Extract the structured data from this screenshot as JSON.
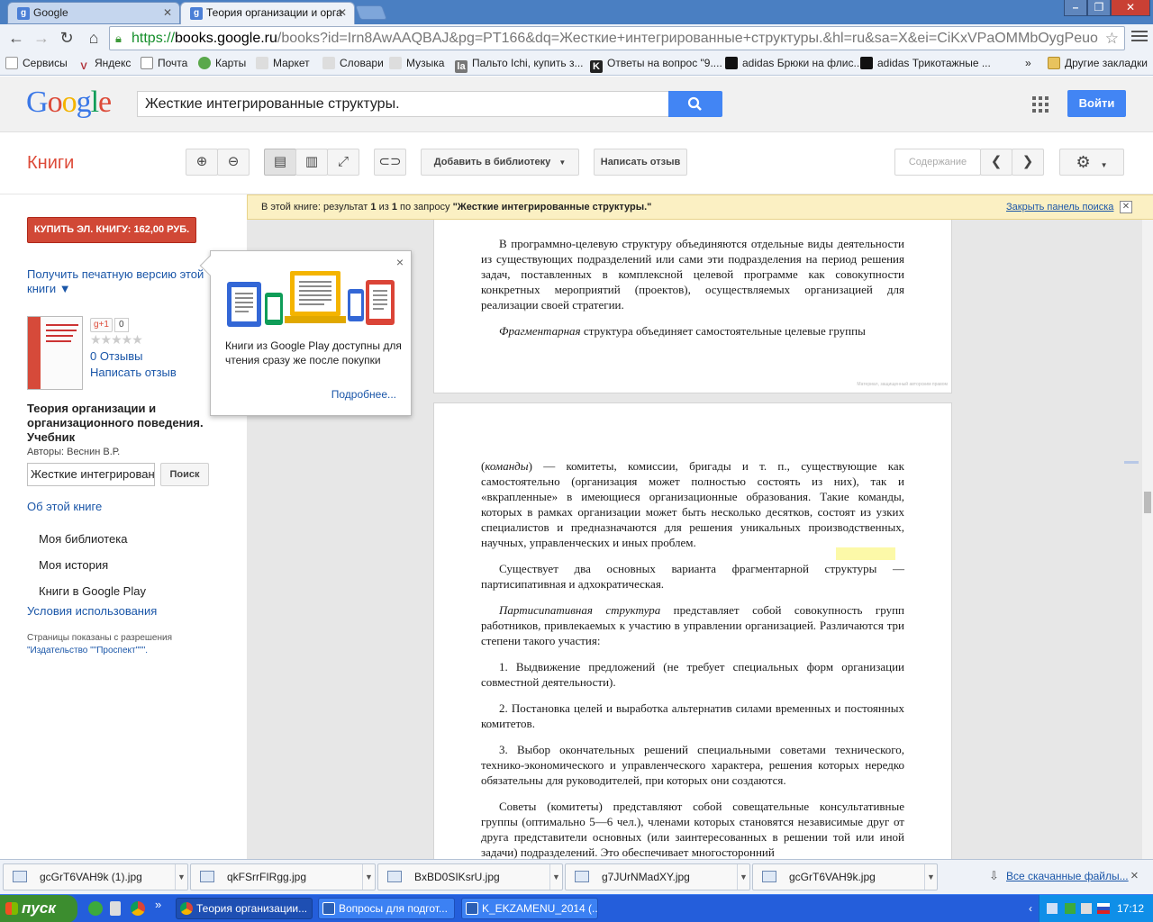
{
  "browser": {
    "tabs": [
      {
        "label": "Google",
        "favicon": "g"
      },
      {
        "label": "Теория организации и орга",
        "favicon": "g"
      }
    ],
    "window_controls": {
      "minimize": "–",
      "maximize": "❐",
      "close": "✕"
    },
    "url": {
      "scheme": "https://",
      "host": "books.google.ru",
      "path": "/books?id=Irn8AwAAQBAJ&pg=PT166&dq=Жесткие+интегрированные+структуры.&hl=ru&sa=X&ei=CiKxVPaOMMbOygPeuo"
    },
    "bookmarks": [
      {
        "label": "Сервисы"
      },
      {
        "label": "Яндекс"
      },
      {
        "label": "Почта"
      },
      {
        "label": "Карты"
      },
      {
        "label": "Маркет"
      },
      {
        "label": "Словари"
      },
      {
        "label": "Музыка"
      },
      {
        "label": "Пальто Ichi, купить з..."
      },
      {
        "label": "Ответы на вопрос \"9...."
      },
      {
        "label": "adidas Брюки на флис..."
      },
      {
        "label": "adidas Трикотажные ..."
      }
    ],
    "bookmarks_more": "»",
    "other_bookmarks": "Другие закладки"
  },
  "google": {
    "logo": "Google",
    "search_value": "Жесткие интегрированные структуры.",
    "signin": "Войти"
  },
  "books": {
    "title": "Книги",
    "add_to_library": "Добавить в библиотеку",
    "write_review": "Написать отзыв",
    "contents": "Содержание",
    "search_banner": {
      "prefix": "В этой книге: результат ",
      "current": "1",
      "of": " из ",
      "total": "1",
      "query_label": " по запросу ",
      "query": "\"Жесткие интегрированные структуры.\"",
      "close_link": "Закрыть панель поиска"
    }
  },
  "sidebar": {
    "buy_button": "КУПИТЬ ЭЛ. КНИГУ: 162,00 РУБ.",
    "print_version": "Получить печатную версию этой книги ▼",
    "gplus_label": "g+1",
    "gplus_count": "0",
    "rating_stars": "★★★★★",
    "reviews_link": "0 Отзывы",
    "write_review_link": "Написать отзыв",
    "book_title": "Теория организации и организационного поведения. Учебник",
    "authors": "Авторы: Веснин В.Р.",
    "search_input": "Жесткие интегрирован",
    "search_button": "Поиск",
    "about_link": "Об этой книге",
    "nav": [
      "Моя библиотека",
      "Моя история",
      "Книги в Google Play"
    ],
    "terms_link": "Условия использования",
    "permission_text": "Страницы показаны с разрешения",
    "publisher": "\"Издательство \"\"Проспект\"\"\"."
  },
  "popup": {
    "text": "Книги из Google Play доступны для чтения сразу же после покупки",
    "more_link": "Подробнее...",
    "close": "×"
  },
  "page1": {
    "paragraph1": "В программно-целевую структуру объединяются отдельные виды деятельности из существующих подразделений или сами эти подразделения на период решения задач, поставленных в комплексной целевой программе как совокупности конкретных мероприятий (проектов), осуществляемых организацией для реализации своей стратегии.",
    "paragraph2_term": "Фрагментарная",
    "paragraph2_rest": " структура объединяет самостоятельные целевые группы",
    "watermark": "Материал, защищенный авторским правом"
  },
  "page2": {
    "p1_open": "(",
    "p1_term": "команды",
    "p1_rest": ") — комитеты, комиссии, бригады и т. п., существующие как самостоятельно (организация может полностью состоять из них), так и «вкрапленные» в имеющиеся организационные образования. Такие команды, которых в рамках организации может быть несколько десятков, состоят из узких специалистов и предназначаются для решения уникальных производственных, научных, управленческих и иных проблем.",
    "p2": "Существует два основных варианта фрагментарной структуры — партисипативная и адхократическая.",
    "p3_term": "Партисипативная структура",
    "p3_rest": " представляет собой совокупность групп работников, привлекаемых к участию в управлении организацией. Различаются три степени такого участия:",
    "p4": "1. Выдвижение предложений (не требует специальных форм организации совместной деятельности).",
    "p5": "2. Постановка целей и выработка альтернатив силами временных и постоянных комитетов.",
    "p6": "3. Выбор окончательных решений специальными советами технического, технико-экономического и управленческого характера, решения которых нередко обязательны для руководителей, при которых они создаются.",
    "p7": "Советы (комитеты) представляют собой совещательные консультативные группы (оптимально 5—6 чел.), членами которых становятся независимые друг от друга представители основных (или заинтересованных в решении той или иной задачи) подразделений. Это обеспечивает многосторонний"
  },
  "downloads": {
    "items": [
      "gcGrT6VAH9k (1).jpg",
      "qkFSrrFIRgg.jpg",
      "BxBD0SIKsrU.jpg",
      "g7JUrNMadXY.jpg",
      "gcGrT6VAH9k.jpg"
    ],
    "all_link": "Все скачанные файлы...",
    "close": "×"
  },
  "taskbar": {
    "start": "пуск",
    "tasks": [
      "Теория организации...",
      "Вопросы для подгот...",
      "K_EKZAMENU_2014 (..."
    ],
    "time": "17:12"
  },
  "colors": {
    "tabstrip": "#4a7fc2",
    "google_blue": "#4285f4",
    "books_red": "#dd4b39",
    "buy_red": "#d14836",
    "link_blue": "#1a56a8",
    "highlight": "#fcf9a8",
    "taskbar": "#245edb",
    "start_green": "#3c8d2f"
  }
}
